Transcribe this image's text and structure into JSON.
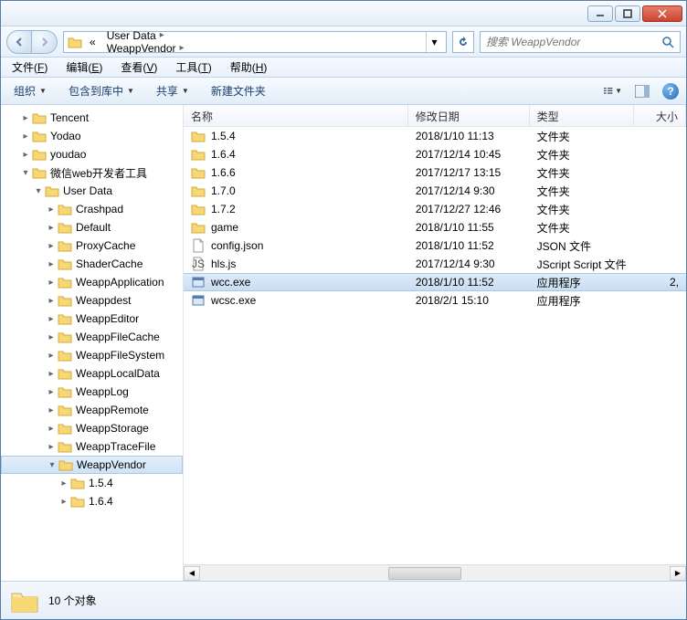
{
  "titlebar": {
    "title": ""
  },
  "nav": {
    "crumbs": [
      "User Data",
      "WeappVendor"
    ],
    "crumb_prefix": "«"
  },
  "search": {
    "placeholder": "搜索 WeappVendor"
  },
  "menus": [
    {
      "label": "文件",
      "key": "F"
    },
    {
      "label": "编辑",
      "key": "E"
    },
    {
      "label": "查看",
      "key": "V"
    },
    {
      "label": "工具",
      "key": "T"
    },
    {
      "label": "帮助",
      "key": "H"
    }
  ],
  "toolbar": {
    "organize": "组织",
    "include": "包含到库中",
    "share": "共享",
    "newfolder": "新建文件夹"
  },
  "tree": [
    {
      "label": "Tencent",
      "depth": 1,
      "expanded": false
    },
    {
      "label": "Yodao",
      "depth": 1,
      "expanded": false
    },
    {
      "label": "youdao",
      "depth": 1,
      "expanded": false
    },
    {
      "label": "微信web开发者工具",
      "depth": 1,
      "expanded": true
    },
    {
      "label": "User Data",
      "depth": 2,
      "expanded": true
    },
    {
      "label": "Crashpad",
      "depth": 3,
      "expanded": false
    },
    {
      "label": "Default",
      "depth": 3,
      "expanded": false
    },
    {
      "label": "ProxyCache",
      "depth": 3,
      "expanded": false
    },
    {
      "label": "ShaderCache",
      "depth": 3,
      "expanded": false
    },
    {
      "label": "WeappApplication",
      "depth": 3,
      "expanded": false
    },
    {
      "label": "Weappdest",
      "depth": 3,
      "expanded": false
    },
    {
      "label": "WeappEditor",
      "depth": 3,
      "expanded": false
    },
    {
      "label": "WeappFileCache",
      "depth": 3,
      "expanded": false
    },
    {
      "label": "WeappFileSystem",
      "depth": 3,
      "expanded": false
    },
    {
      "label": "WeappLocalData",
      "depth": 3,
      "expanded": false
    },
    {
      "label": "WeappLog",
      "depth": 3,
      "expanded": false
    },
    {
      "label": "WeappRemote",
      "depth": 3,
      "expanded": false
    },
    {
      "label": "WeappStorage",
      "depth": 3,
      "expanded": false
    },
    {
      "label": "WeappTraceFile",
      "depth": 3,
      "expanded": false
    },
    {
      "label": "WeappVendor",
      "depth": 3,
      "expanded": true,
      "selected": true
    },
    {
      "label": "1.5.4",
      "depth": 4,
      "expanded": false
    },
    {
      "label": "1.6.4",
      "depth": 4,
      "expanded": false
    }
  ],
  "columns": {
    "name": "名称",
    "date": "修改日期",
    "type": "类型",
    "size": "大小"
  },
  "files": [
    {
      "name": "1.5.4",
      "date": "2018/1/10 11:13",
      "type": "文件夹",
      "icon": "folder"
    },
    {
      "name": "1.6.4",
      "date": "2017/12/14 10:45",
      "type": "文件夹",
      "icon": "folder"
    },
    {
      "name": "1.6.6",
      "date": "2017/12/17 13:15",
      "type": "文件夹",
      "icon": "folder"
    },
    {
      "name": "1.7.0",
      "date": "2017/12/14 9:30",
      "type": "文件夹",
      "icon": "folder"
    },
    {
      "name": "1.7.2",
      "date": "2017/12/27 12:46",
      "type": "文件夹",
      "icon": "folder"
    },
    {
      "name": "game",
      "date": "2018/1/10 11:55",
      "type": "文件夹",
      "icon": "folder"
    },
    {
      "name": "config.json",
      "date": "2018/1/10 11:52",
      "type": "JSON 文件",
      "icon": "file"
    },
    {
      "name": "hls.js",
      "date": "2017/12/14 9:30",
      "type": "JScript Script 文件",
      "icon": "js"
    },
    {
      "name": "wcc.exe",
      "date": "2018/1/10 11:52",
      "type": "应用程序",
      "icon": "exe",
      "size": "2,",
      "selected": true
    },
    {
      "name": "wcsc.exe",
      "date": "2018/2/1 15:10",
      "type": "应用程序",
      "icon": "exe"
    }
  ],
  "status": {
    "count": "10 个对象"
  }
}
